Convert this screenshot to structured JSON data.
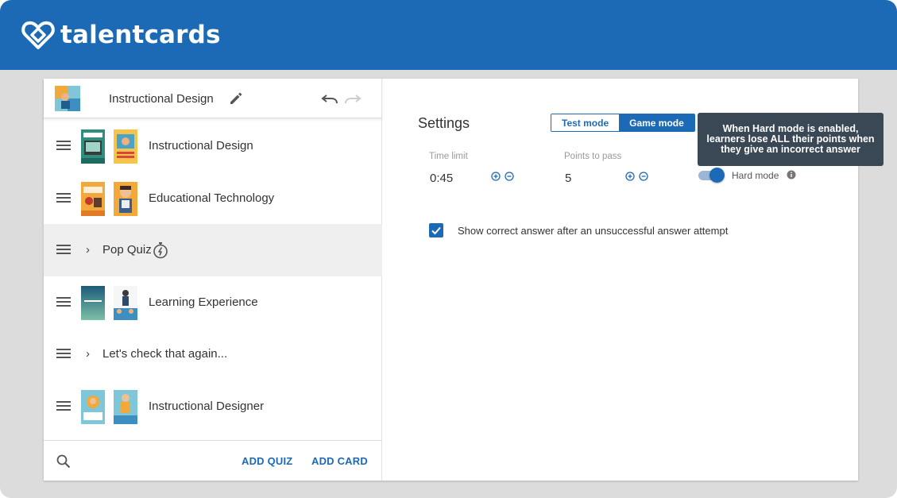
{
  "brand": {
    "name": "talentcards",
    "logo_icon": "heart-card-logo-icon",
    "color": "#1c6ab5"
  },
  "deck": {
    "title": "Instructional Design",
    "edit_icon": "pencil-icon",
    "undo_icon": "undo-icon",
    "redo_icon": "redo-icon"
  },
  "list": [
    {
      "type": "set",
      "label": "Instructional Design",
      "drag_icon": "drag-handle-icon"
    },
    {
      "type": "set",
      "label": "Educational Technology",
      "drag_icon": "drag-handle-icon"
    },
    {
      "type": "quiz",
      "label": "Pop Quiz",
      "drag_icon": "drag-handle-icon",
      "chevron_icon": "chevron-right-icon",
      "timer_icon": "stopwatch-icon",
      "selected": true
    },
    {
      "type": "set",
      "label": "Learning Experience",
      "drag_icon": "drag-handle-icon"
    },
    {
      "type": "quiz",
      "label": "Let's check that again...",
      "drag_icon": "drag-handle-icon",
      "chevron_icon": "chevron-right-icon"
    },
    {
      "type": "set",
      "label": "Instructional Designer",
      "drag_icon": "drag-handle-icon"
    }
  ],
  "footer": {
    "search_icon": "search-icon",
    "add_quiz_label": "ADD QUIZ",
    "add_card_label": "ADD CARD"
  },
  "settings": {
    "title": "Settings",
    "modes": {
      "test_label": "Test mode",
      "game_label": "Game mode",
      "selected": "Game mode"
    },
    "time_limit": {
      "label": "Time limit",
      "value": "0:45"
    },
    "points_to_pass": {
      "label": "Points to pass",
      "value": "5"
    },
    "stepper_icons": {
      "plus": "plus-circle-icon",
      "minus": "minus-circle-icon"
    },
    "hard_mode": {
      "label": "Hard mode",
      "enabled": true,
      "info_icon": "info-icon"
    },
    "tooltip": {
      "line1": "When Hard mode is enabled,",
      "line2": "learners lose ALL their points when",
      "line3": "they give an incorrect answer"
    },
    "show_correct": {
      "label": "Show correct answer after an unsuccessful answer attempt",
      "checked": true
    }
  }
}
